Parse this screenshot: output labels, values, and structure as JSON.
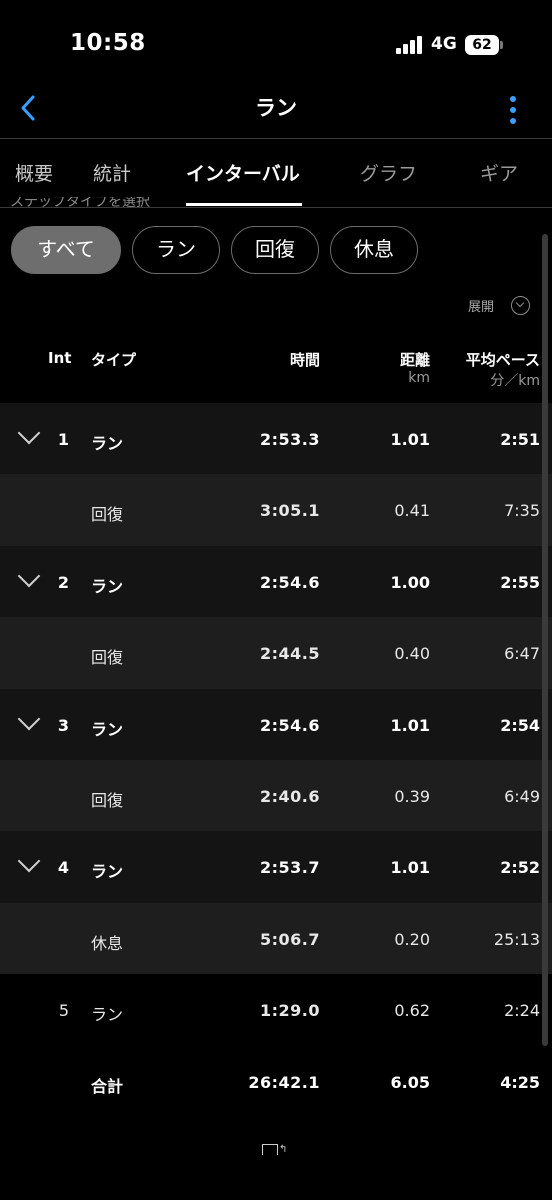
{
  "status_bar": {
    "time": "10:58",
    "network": "4G",
    "battery": "62"
  },
  "header": {
    "title": "ラン",
    "back_icon": "chevron-left-icon",
    "menu_icon": "more-vertical-icon",
    "accent": "#3aa0ff"
  },
  "tabs": [
    {
      "label": "概要"
    },
    {
      "label": "統計"
    },
    {
      "label": "インターバル",
      "active": true
    },
    {
      "label": "グラフ"
    },
    {
      "label": "ギア"
    }
  ],
  "filter_hint": "ステップタイプを選択",
  "filters": [
    {
      "label": "すべて",
      "selected": true
    },
    {
      "label": "ラン"
    },
    {
      "label": "回復"
    },
    {
      "label": "休息"
    }
  ],
  "expand_label": "展開",
  "table": {
    "columns": {
      "int": "Int",
      "type": "タイプ",
      "time": "時間",
      "distance": "距離",
      "distance_unit": "km",
      "pace": "平均ペース",
      "pace_unit": "分／km"
    },
    "rows": [
      {
        "int": "1",
        "type": "ラン",
        "time": "2:53.3",
        "distance": "1.01",
        "pace": "2:51",
        "kind": "run",
        "expandable": true
      },
      {
        "int": "",
        "type": "回復",
        "time": "3:05.1",
        "distance": "0.41",
        "pace": "7:35",
        "kind": "rec"
      },
      {
        "int": "2",
        "type": "ラン",
        "time": "2:54.6",
        "distance": "1.00",
        "pace": "2:55",
        "kind": "run",
        "expandable": true
      },
      {
        "int": "",
        "type": "回復",
        "time": "2:44.5",
        "distance": "0.40",
        "pace": "6:47",
        "kind": "rec"
      },
      {
        "int": "3",
        "type": "ラン",
        "time": "2:54.6",
        "distance": "1.01",
        "pace": "2:54",
        "kind": "run",
        "expandable": true
      },
      {
        "int": "",
        "type": "回復",
        "time": "2:40.6",
        "distance": "0.39",
        "pace": "6:49",
        "kind": "rec"
      },
      {
        "int": "4",
        "type": "ラン",
        "time": "2:53.7",
        "distance": "1.01",
        "pace": "2:52",
        "kind": "run",
        "expandable": true
      },
      {
        "int": "",
        "type": "休息",
        "time": "5:06.7",
        "distance": "0.20",
        "pace": "25:13",
        "kind": "rec"
      },
      {
        "int": "5",
        "type": "ラン",
        "time": "1:29.0",
        "distance": "0.62",
        "pace": "2:24",
        "kind": "plain"
      }
    ],
    "total": {
      "label": "合計",
      "time": "26:42.1",
      "distance": "6.05",
      "pace": "4:25"
    }
  }
}
